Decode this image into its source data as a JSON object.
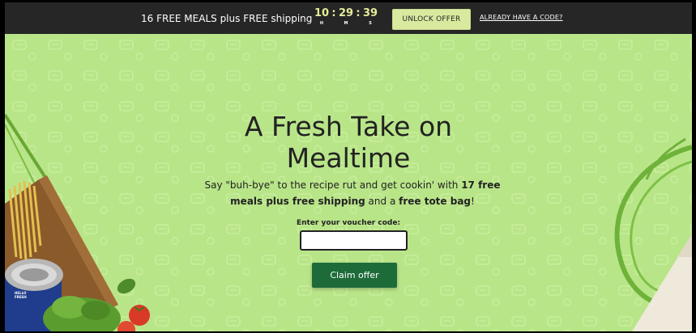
{
  "topbar": {
    "promo_text": "16 FREE MEALS plus FREE shipping",
    "timer": {
      "hours": "10",
      "minutes": "29",
      "seconds": "39",
      "separator": ":",
      "hours_label": "H",
      "minutes_label": "M",
      "seconds_label": "S"
    },
    "unlock_label": "UNLOCK OFFER",
    "code_link": "ALREADY HAVE A CODE?"
  },
  "hero": {
    "headline_line1": "A Fresh Take on",
    "headline_line2": "Mealtime",
    "sub_part1": "Say \"buh-bye\" to the recipe rut and get cookin' with ",
    "sub_bold1": "17 free meals plus free shipping",
    "sub_part2": " and a ",
    "sub_bold2": "free tote bag",
    "sub_part3": "!",
    "voucher_label": "Enter your voucher code:",
    "voucher_value": "",
    "claim_label": "Claim offer"
  },
  "decorations": {
    "can_label": "HELLO FRESH"
  },
  "colors": {
    "topbar_bg": "#262626",
    "timer": "#e6ed98",
    "unlock_bg": "#d9ea9f",
    "hero_bg": "#b9e589",
    "claim_bg": "#1e6b3a",
    "swirl": "#6fb23a"
  }
}
